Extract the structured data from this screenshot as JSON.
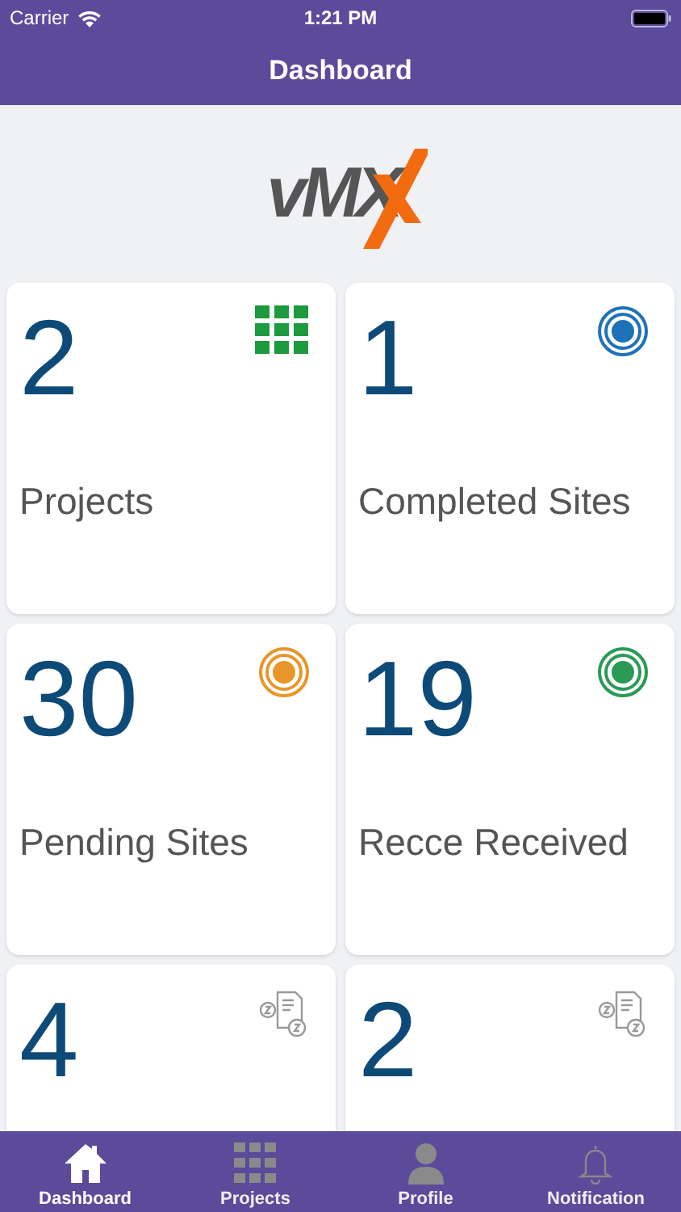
{
  "status_bar": {
    "carrier": "Carrier",
    "time": "1:21 PM"
  },
  "nav_bar": {
    "title": "Dashboard"
  },
  "logo": {
    "text": "vMX"
  },
  "cards": [
    {
      "count": "2",
      "label": "Projects",
      "kind": "grid",
      "color": "#1e9a3e"
    },
    {
      "count": "1",
      "label": "Completed Sites",
      "kind": "target",
      "color": "#1f72b8"
    },
    {
      "count": "30",
      "label": "Pending Sites",
      "kind": "target",
      "color": "#e8962a"
    },
    {
      "count": "19",
      "label": "Recce Received",
      "kind": "target",
      "color": "#2a9a55"
    },
    {
      "count": "4",
      "kind": "document"
    },
    {
      "count": "2",
      "kind": "document"
    }
  ],
  "tab_bar": [
    {
      "label": "Dashboard",
      "kind": "home",
      "selected": true
    },
    {
      "label": "Projects",
      "kind": "grid",
      "selected": false
    },
    {
      "label": "Profile",
      "kind": "person",
      "selected": false
    },
    {
      "label": "Notification",
      "kind": "bell",
      "selected": false
    }
  ]
}
